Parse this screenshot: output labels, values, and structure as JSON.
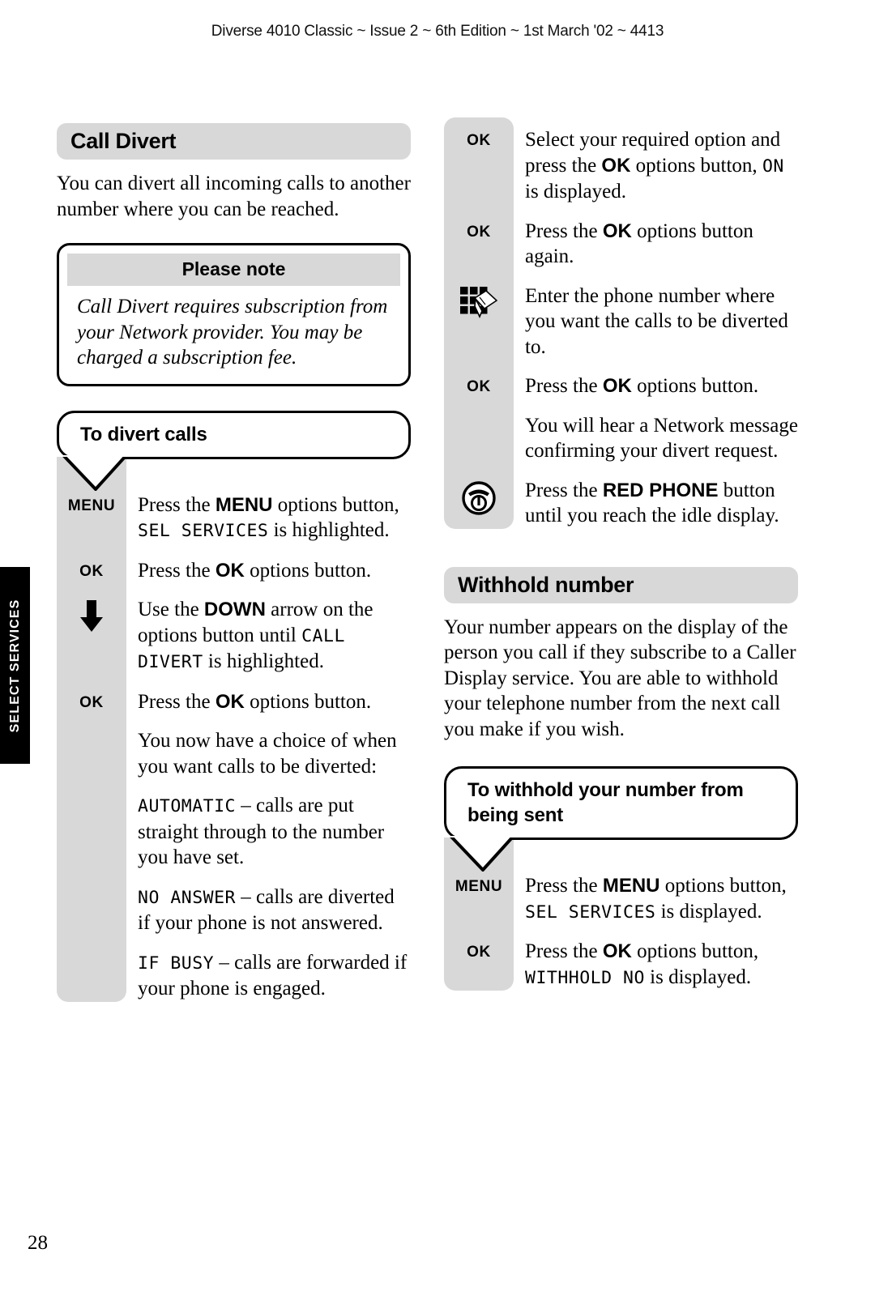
{
  "header": {
    "running_head": "Diverse 4010 Classic ~ Issue 2 ~ 6th Edition ~ 1st March '02 ~ 4413"
  },
  "side_tab": {
    "label": "SELECT SERVICES"
  },
  "page_number": "28",
  "colors": {
    "panel_gray": "#d8d8d8",
    "tab_black": "#000000",
    "page_white": "#ffffff"
  },
  "left_column": {
    "section_title": "Call Divert",
    "intro": "You can divert all incoming calls to another number where you can be reached.",
    "note": {
      "title": "Please note",
      "body": "Call Divert requires subscription from your Network provider. You may be charged a subscription fee."
    },
    "callout": "To divert calls",
    "steps": [
      {
        "key": "MENU",
        "icon": "",
        "parts": [
          {
            "t": "Press the ",
            "s": "plain"
          },
          {
            "t": "MENU",
            "s": "bold"
          },
          {
            "t": " options button, ",
            "s": "plain"
          },
          {
            "t": "SEL  SERVICES",
            "s": "lcd"
          },
          {
            "t": " is highlighted.",
            "s": "plain"
          }
        ]
      },
      {
        "key": "OK",
        "icon": "",
        "parts": [
          {
            "t": "Press the ",
            "s": "plain"
          },
          {
            "t": "OK",
            "s": "bold"
          },
          {
            "t": " options button.",
            "s": "plain"
          }
        ]
      },
      {
        "key": "",
        "icon": "arrow-down-icon",
        "parts": [
          {
            "t": "Use the ",
            "s": "plain"
          },
          {
            "t": "DOWN",
            "s": "bold"
          },
          {
            "t": " arrow on the options button until ",
            "s": "plain"
          },
          {
            "t": "CALL DIVERT",
            "s": "lcd"
          },
          {
            "t": " is highlighted.",
            "s": "plain"
          }
        ]
      },
      {
        "key": "OK",
        "icon": "",
        "parts": [
          {
            "t": "Press the ",
            "s": "plain"
          },
          {
            "t": "OK",
            "s": "bold"
          },
          {
            "t": " options button.",
            "s": "plain"
          }
        ]
      },
      {
        "key": "",
        "icon": "",
        "parts": [
          {
            "t": "You now have a choice of when you want calls to be diverted:",
            "s": "plain"
          }
        ]
      },
      {
        "key": "",
        "icon": "",
        "parts": [
          {
            "t": "AUTOMATIC",
            "s": "lcd"
          },
          {
            "t": " – calls are put straight through to the number you have set.",
            "s": "plain"
          }
        ]
      },
      {
        "key": "",
        "icon": "",
        "parts": [
          {
            "t": "NO  ANSWER",
            "s": "lcd"
          },
          {
            "t": " – calls are diverted if your phone is not answered.",
            "s": "plain"
          }
        ]
      },
      {
        "key": "",
        "icon": "",
        "parts": [
          {
            "t": "IF  BUSY",
            "s": "lcd"
          },
          {
            "t": " – calls are forwarded if your phone is engaged.",
            "s": "plain"
          }
        ]
      }
    ]
  },
  "right_column": {
    "continued_steps": [
      {
        "key": "OK",
        "icon": "",
        "parts": [
          {
            "t": "Select your required option and press the ",
            "s": "plain"
          },
          {
            "t": "OK",
            "s": "bold"
          },
          {
            "t": " options button, ",
            "s": "plain"
          },
          {
            "t": "ON",
            "s": "lcd"
          },
          {
            "t": " is displayed.",
            "s": "plain"
          }
        ]
      },
      {
        "key": "OK",
        "icon": "",
        "parts": [
          {
            "t": "Press the ",
            "s": "plain"
          },
          {
            "t": "OK",
            "s": "bold"
          },
          {
            "t": " options button again.",
            "s": "plain"
          }
        ]
      },
      {
        "key": "",
        "icon": "keypad-icon",
        "parts": [
          {
            "t": "Enter the phone number where you want the calls to be diverted to.",
            "s": "plain"
          }
        ]
      },
      {
        "key": "OK",
        "icon": "",
        "parts": [
          {
            "t": "Press the ",
            "s": "plain"
          },
          {
            "t": "OK",
            "s": "bold"
          },
          {
            "t": " options button.",
            "s": "plain"
          }
        ]
      },
      {
        "key": "",
        "icon": "",
        "parts": [
          {
            "t": "You will hear a Network message confirming your divert request.",
            "s": "plain"
          }
        ]
      },
      {
        "key": "",
        "icon": "red-phone-icon",
        "parts": [
          {
            "t": "Press the ",
            "s": "plain"
          },
          {
            "t": "RED PHONE",
            "s": "bold"
          },
          {
            "t": " button until you reach the idle display.",
            "s": "plain"
          }
        ]
      }
    ],
    "section_title": "Withhold number",
    "intro": "Your number appears on the display of the person you call if they subscribe to a Caller Display service. You are able to withhold your telephone number from the next call you make if you wish.",
    "callout": "To withhold your number from being sent",
    "steps": [
      {
        "key": "MENU",
        "icon": "",
        "parts": [
          {
            "t": "Press the ",
            "s": "plain"
          },
          {
            "t": "MENU",
            "s": "bold"
          },
          {
            "t": " options button, ",
            "s": "plain"
          },
          {
            "t": "SEL  SERVICES",
            "s": "lcd"
          },
          {
            "t": " is displayed.",
            "s": "plain"
          }
        ]
      },
      {
        "key": "OK",
        "icon": "",
        "parts": [
          {
            "t": "Press the ",
            "s": "plain"
          },
          {
            "t": "OK",
            "s": "bold"
          },
          {
            "t": " options button, ",
            "s": "plain"
          },
          {
            "t": "WITHHOLD  NO",
            "s": "lcd"
          },
          {
            "t": " is displayed.",
            "s": "plain"
          }
        ]
      }
    ]
  }
}
